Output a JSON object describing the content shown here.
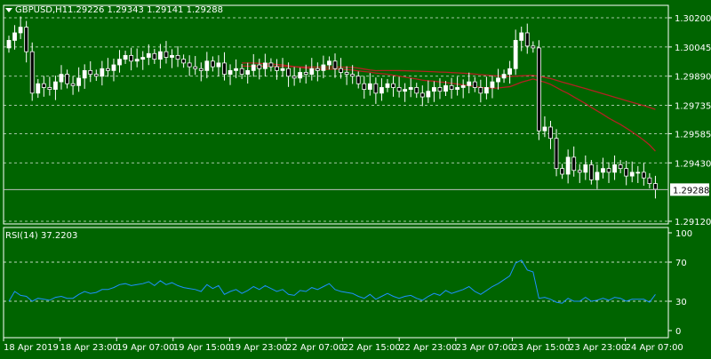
{
  "header": {
    "symbol_label": "GBPUSD,H1",
    "ohlc_label": "1.29226 1.29343 1.29141 1.29288",
    "menu_icon": "triangle-down-icon"
  },
  "indicator": {
    "label": "RSI(14) 37.2203"
  },
  "colors": {
    "background": "#006400",
    "grid": "#ffffff",
    "bull_candle": "#ffffff",
    "bear_candle": "#000000",
    "ma": "#b22222",
    "rsi_line": "#1e90ff",
    "bid_line": "#c0c0c0"
  },
  "chart_data": [
    {
      "type": "candlestick",
      "ylim": [
        1.2912,
        1.302
      ],
      "y_ticks": [
        "1.30200",
        "1.30045",
        "1.29890",
        "1.29735",
        "1.29585",
        "1.29430",
        "1.29120"
      ],
      "bid_label": "1.29288",
      "x_ticks": [
        "18 Apr 2019",
        "18 Apr 23:00",
        "19 Apr 07:00",
        "19 Apr 15:00",
        "19 Apr 23:00",
        "22 Apr 07:00",
        "22 Apr 15:00",
        "22 Apr 23:00",
        "23 Apr 07:00",
        "23 Apr 15:00",
        "23 Apr 23:00",
        "24 Apr 07:00"
      ],
      "close": [
        1.3008,
        1.3012,
        1.3015,
        1.3002,
        1.298,
        1.2985,
        1.2983,
        1.2982,
        1.2986,
        1.299,
        1.2985,
        1.2984,
        1.2988,
        1.2992,
        1.299,
        1.2989,
        1.2993,
        1.2992,
        1.2995,
        1.2998,
        1.3,
        1.2997,
        1.2998,
        1.2999,
        1.3001,
        1.2998,
        1.3002,
        1.2999,
        1.3,
        1.2998,
        1.2996,
        1.2994,
        1.2993,
        1.2992,
        1.2997,
        1.2994,
        1.2996,
        1.299,
        1.2992,
        1.2993,
        1.299,
        1.2992,
        1.2995,
        1.2993,
        1.2996,
        1.2994,
        1.2992,
        1.2993,
        1.2989,
        1.2988,
        1.2991,
        1.299,
        1.2993,
        1.2992,
        1.2995,
        1.2997,
        1.2993,
        1.2991,
        1.299,
        1.2989,
        1.2985,
        1.2982,
        1.2985,
        1.298,
        1.2983,
        1.2985,
        1.2983,
        1.2981,
        1.2982,
        1.2983,
        1.298,
        1.2978,
        1.2981,
        1.2983,
        1.2981,
        1.2984,
        1.2982,
        1.2983,
        1.2984,
        1.2986,
        1.2983,
        1.298,
        1.2983,
        1.2986,
        1.2988,
        1.299,
        1.2993,
        1.3008,
        1.3012,
        1.3005,
        1.3004,
        1.296,
        1.2962,
        1.2956,
        1.294,
        1.2937,
        1.2946,
        1.2939,
        1.2938,
        1.2942,
        1.2934,
        1.2938,
        1.294,
        1.2938,
        1.2942,
        1.294,
        1.2936,
        1.2938,
        1.2938,
        1.2935,
        1.2932,
        1.2929
      ]
    },
    {
      "type": "line",
      "title": "RSI(14) 37.2203",
      "ylim": [
        0,
        100
      ],
      "y_ticks": [
        "100",
        "70",
        "30",
        "0"
      ],
      "levels": [
        70,
        30
      ],
      "values": [
        30,
        40,
        36,
        35,
        30,
        33,
        32,
        31,
        34,
        35,
        33,
        33,
        37,
        40,
        38,
        39,
        42,
        42,
        44,
        47,
        48,
        46,
        47,
        48,
        50,
        46,
        51,
        47,
        49,
        46,
        44,
        43,
        42,
        40,
        47,
        43,
        46,
        37,
        40,
        42,
        38,
        41,
        45,
        42,
        46,
        43,
        40,
        42,
        37,
        36,
        41,
        40,
        44,
        42,
        45,
        48,
        42,
        40,
        39,
        38,
        35,
        33,
        37,
        32,
        35,
        38,
        35,
        33,
        35,
        36,
        33,
        31,
        35,
        38,
        36,
        41,
        38,
        40,
        42,
        45,
        40,
        37,
        41,
        45,
        48,
        52,
        56,
        69,
        72,
        62,
        60,
        33,
        34,
        32,
        29,
        28,
        33,
        30,
        30,
        34,
        30,
        31,
        33,
        31,
        34,
        33,
        30,
        32,
        32,
        32,
        29,
        37
      ]
    }
  ]
}
